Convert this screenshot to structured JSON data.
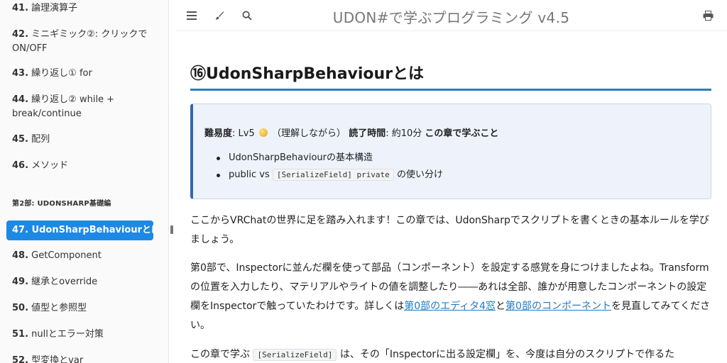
{
  "header": {
    "book_title": "UDON#で学ぶプログラミング v4.5"
  },
  "sidebar": {
    "items_before": [
      {
        "num": "41.",
        "label": "論理演算子"
      },
      {
        "num": "42.",
        "label": "ミニギミック②: クリックで",
        "label2": "ON/OFF"
      },
      {
        "num": "43.",
        "label": "繰り返し① for"
      },
      {
        "num": "44.",
        "label": "繰り返し② while +",
        "label2": "break/continue"
      },
      {
        "num": "45.",
        "label": "配列"
      },
      {
        "num": "46.",
        "label": "メソッド"
      }
    ],
    "part_heading": "第2部: UDONSHARP基礎編",
    "active_item": {
      "num": "47.",
      "label": "UdonSharpBehaviourとは"
    },
    "items_after": [
      {
        "num": "48.",
        "label": "GetComponent"
      },
      {
        "num": "49.",
        "label": "継承とoverride"
      },
      {
        "num": "50.",
        "label": "値型と参照型"
      },
      {
        "num": "51.",
        "label": "nullとエラー対策"
      },
      {
        "num": "52.",
        "label": "型変換とvar"
      }
    ]
  },
  "chapter": {
    "title": "⑯UdonSharpBehaviourとは",
    "meta": {
      "difficulty_label": "難易度",
      "difficulty_value": ": Lv5",
      "difficulty_note": "（理解しながら）",
      "time_label": "読了時間",
      "time_value": ": 約10分",
      "learn_label": "この章で学ぶこと"
    },
    "goals": [
      {
        "text": "UdonSharpBehaviourの基本構造"
      },
      {
        "pre": "public vs ",
        "code": "[SerializeField] private",
        "post": " の使い分け"
      }
    ],
    "paragraphs": {
      "p1": "ここからVRChatの世界に足を踏み入れます！この章では、UdonSharpでスクリプトを書くときの基本ルールを学びましょう。",
      "p2_a": "第0部で、Inspectorに並んだ欄を使って部品（コンポーネント）を設定する感覚を身につけましたよね。Transformの位置を入力したり、マテリアルやライトの値を調整したり――あれは全部、誰かが用意したコンポーネントの設定欄をInspectorで触っていたわけです。詳しくは",
      "p2_link1": "第0部のエディタ4窓",
      "p2_and": "と",
      "p2_link2": "第0部のコンポーネント",
      "p2_b": "を見直してみてください。",
      "p3_a": "この章で学ぶ ",
      "p3_code": "[SerializeField]",
      "p3_b": " は、その「Inspectorに出る設定欄」を、今度は自分のスクリプトで作るた"
    }
  },
  "colors": {
    "accent": "#1e88e5",
    "title_rule": "#2a80c0",
    "infobox_border": "#2f69b1",
    "link": "#1e7bc4"
  },
  "icons": [
    "menu-icon",
    "brush-icon",
    "search-icon",
    "print-icon",
    "medal-icon"
  ]
}
